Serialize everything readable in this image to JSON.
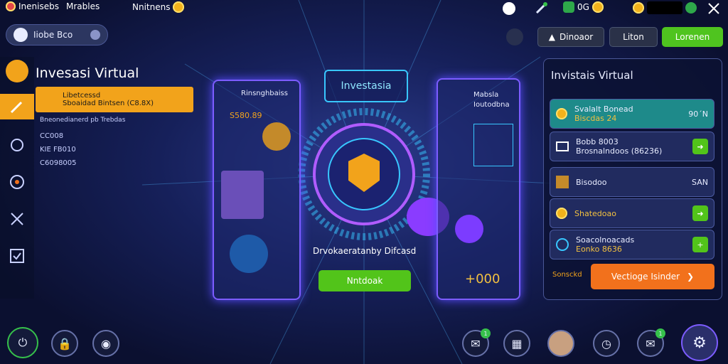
{
  "topbar": {
    "title": "Inenisebs",
    "subtitle": "Mrables",
    "center_text": "Nnitnens",
    "count": "0G"
  },
  "header": {
    "user_pill": "Iiobe Bco",
    "btn_a": "Dinoaor",
    "btn_b": "Liton",
    "btn_c": "Lorenen"
  },
  "left_panel": {
    "title": "Invesasi Virtual",
    "card_line1": "Libetcessd",
    "card_line2": "Sboaidad Bintsen (C8.8X)",
    "note": "Bneonedianerd pb Trebdas",
    "items": [
      "CC008",
      "KIE FB010",
      "C6098005"
    ]
  },
  "center": {
    "card_left_title": "Rinsnghbaiss",
    "card_left_value": "S580.89",
    "main_title": "Investasia",
    "card_right_line1": "Mabsla",
    "card_right_line2": "Ioutodbna",
    "caption": "Drvokaeratanby Difcasd",
    "primary_btn": "Nntdoak",
    "amount": "+000"
  },
  "right_panel": {
    "title": "Invistais Virtual",
    "rows": [
      {
        "line1": "Svalalt Bonead",
        "line2": "Biscdas 24",
        "value": "90´N"
      },
      {
        "line1": "Bobb 8003",
        "line2": "Brosnalndoos (86236)",
        "value": ""
      },
      {
        "line1": "Bisodoo",
        "line2": "",
        "value": "SAN"
      },
      {
        "line1": "Shatedoao",
        "line2": "",
        "value": ""
      },
      {
        "line1": "Soacolnoacads",
        "line2": "Eonko 8636",
        "value": ""
      }
    ],
    "footer_label": "Sonsckd",
    "cta": "Vectioge Isinder"
  },
  "colors": {
    "accent": "#7c5cff",
    "green": "#52c41a",
    "orange": "#f2711c",
    "gold": "#f2b21b"
  }
}
